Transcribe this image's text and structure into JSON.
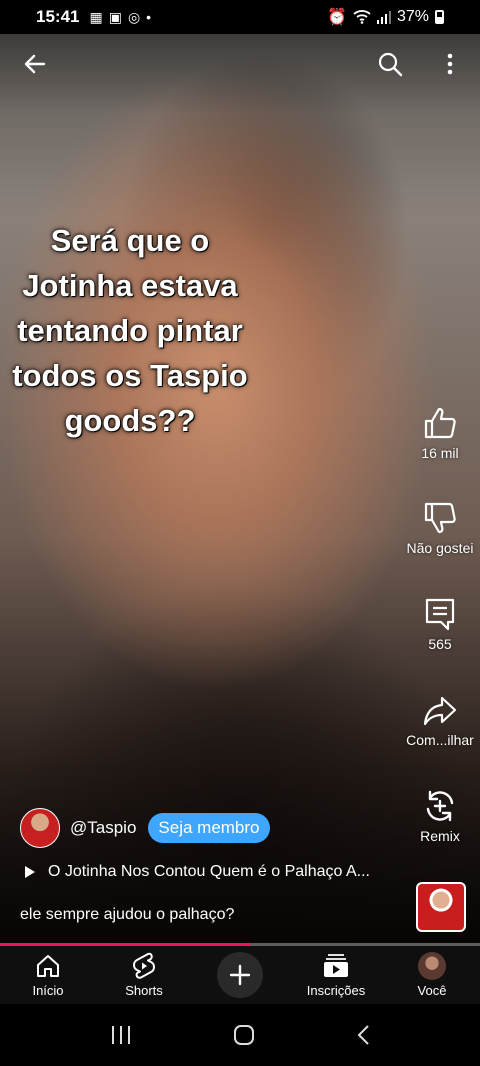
{
  "status_bar": {
    "time": "15:41",
    "battery": "37%"
  },
  "caption": {
    "lines": [
      "Será que o",
      "Jotinha estava",
      "tentando pintar",
      "todos os Taspio",
      "goods??"
    ]
  },
  "actions": {
    "like_count": "16 mil",
    "dislike_label": "Não gostei",
    "comments_count": "565",
    "share_label": "Com...ilhar",
    "remix_label": "Remix"
  },
  "channel": {
    "handle": "@Taspio",
    "member_button": "Seja membro"
  },
  "music": {
    "title": "O Jotinha Nos Contou Quem é o Palhaço A..."
  },
  "description": "ele sempre ajudou o palhaço?",
  "progress": {
    "fraction": 0.52
  },
  "bottom_nav": {
    "home": "Início",
    "shorts": "Shorts",
    "subscriptions": "Inscrições",
    "you": "Você"
  },
  "colors": {
    "accent": "#3ea6ff",
    "progress": "#f0145a"
  }
}
